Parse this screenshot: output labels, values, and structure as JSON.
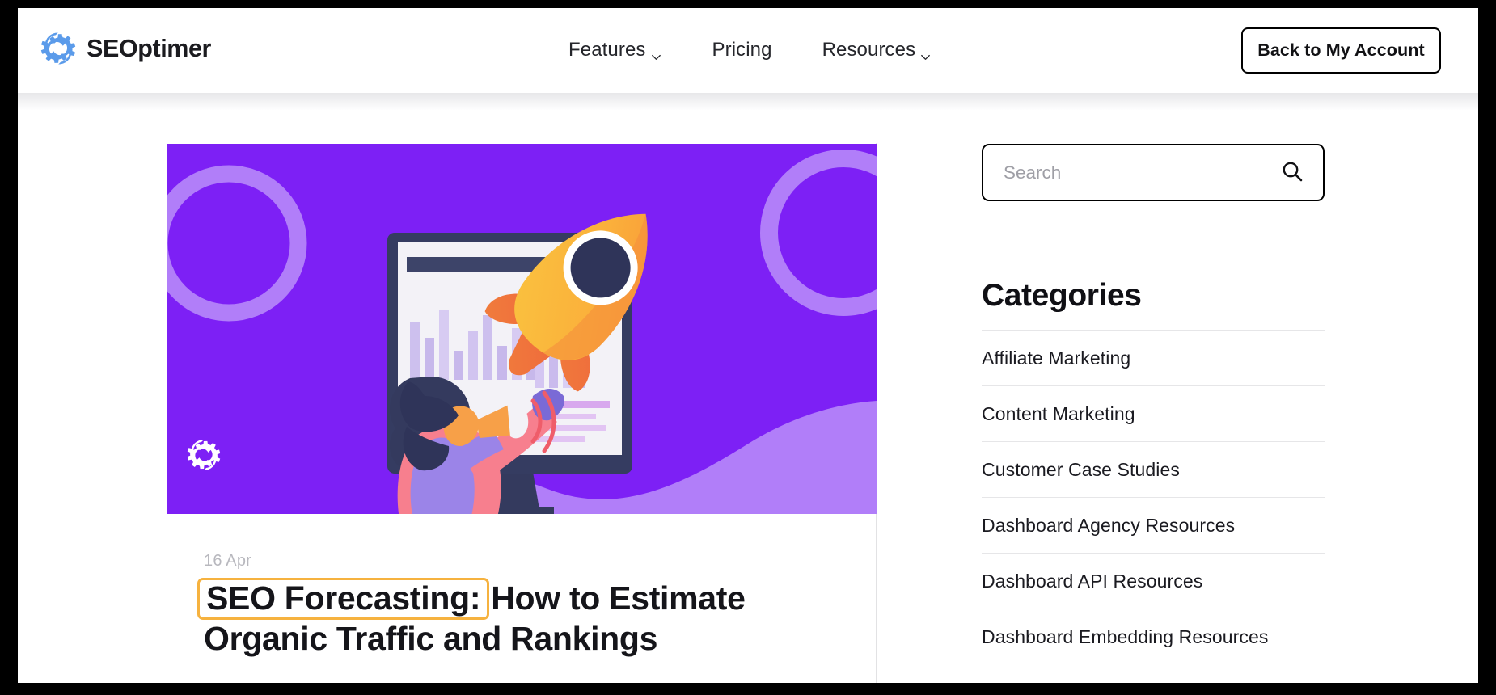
{
  "header": {
    "brand_name": "SEOptimer",
    "brand_icon": "gears-logo-icon",
    "nav": [
      {
        "label": "Features",
        "has_dropdown": true,
        "icon": "chevron-down-icon"
      },
      {
        "label": "Pricing",
        "has_dropdown": false,
        "icon": ""
      },
      {
        "label": "Resources",
        "has_dropdown": true,
        "icon": "chevron-down-icon"
      }
    ],
    "account_button": "Back to My Account"
  },
  "article": {
    "date": "16 Apr",
    "title_highlighted": "SEO Forecasting:",
    "title_rest": "How to Estimate Organic Traffic and Rankings",
    "highlight_color": "#f6b23f",
    "hero": {
      "background_color": "#7d20f5",
      "accent_color": "#b17ef9",
      "watermark_icon": "seoptimer-gears-watermark-icon",
      "illustration": "woman-with-megaphone-rocket-monitor-analytics"
    }
  },
  "sidebar": {
    "search": {
      "placeholder": "Search",
      "value": "",
      "icon": "search-icon"
    },
    "categories_heading": "Categories",
    "categories": [
      "Affiliate Marketing",
      "Content Marketing",
      "Customer Case Studies",
      "Dashboard Agency Resources",
      "Dashboard API Resources",
      "Dashboard Embedding Resources"
    ]
  }
}
